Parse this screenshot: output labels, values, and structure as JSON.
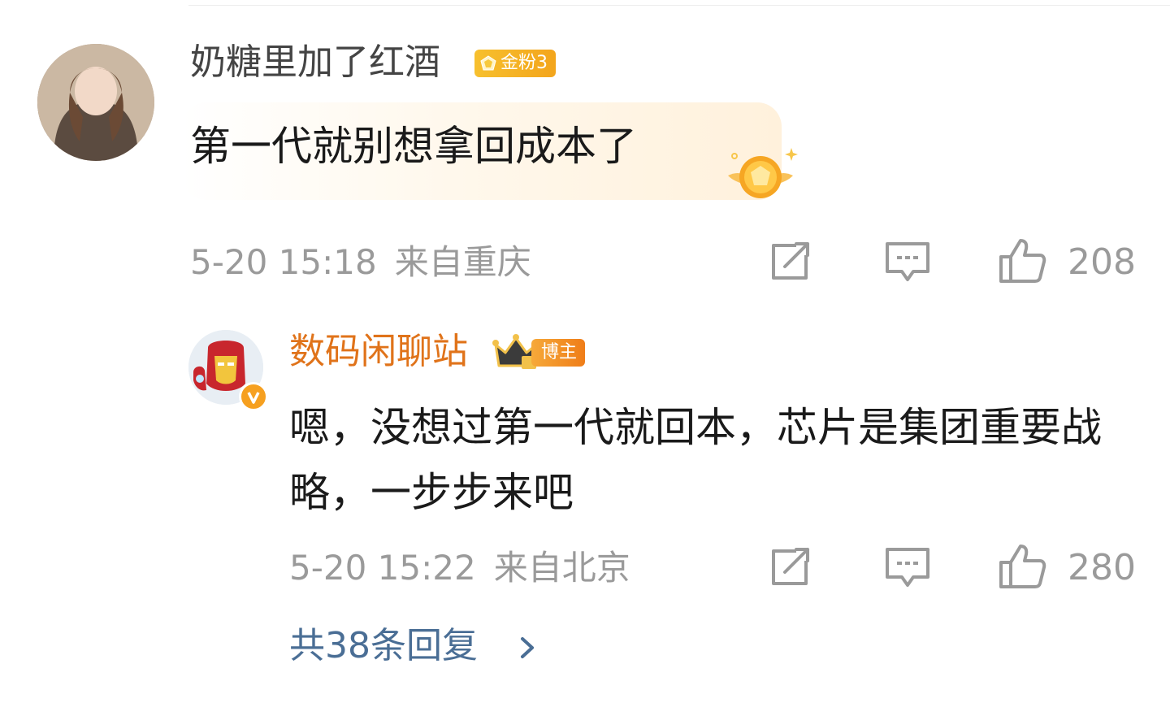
{
  "comment": {
    "username": "奶糖里加了红酒",
    "badge": "金粉3",
    "text": "第一代就别想拿回成本了",
    "date": "5-20 15:18",
    "location": "来自重庆",
    "likes": "208",
    "icons": [
      "share-icon",
      "comment-icon",
      "like-icon"
    ]
  },
  "reply": {
    "username": "数码闲聊站",
    "badge": "博主",
    "text": "嗯，没想过第一代就回本，芯片是集团重要战略，一步步来吧",
    "date": "5-20 15:22",
    "location": "来自北京",
    "likes": "280",
    "icons": [
      "share-icon",
      "comment-icon",
      "like-icon"
    ]
  },
  "more_replies": "共38条回复",
  "colors": {
    "reply_username": "#e0731a",
    "link": "#4a6e95",
    "meta": "#9a9a9a",
    "badge_gold": "#f5b325"
  }
}
